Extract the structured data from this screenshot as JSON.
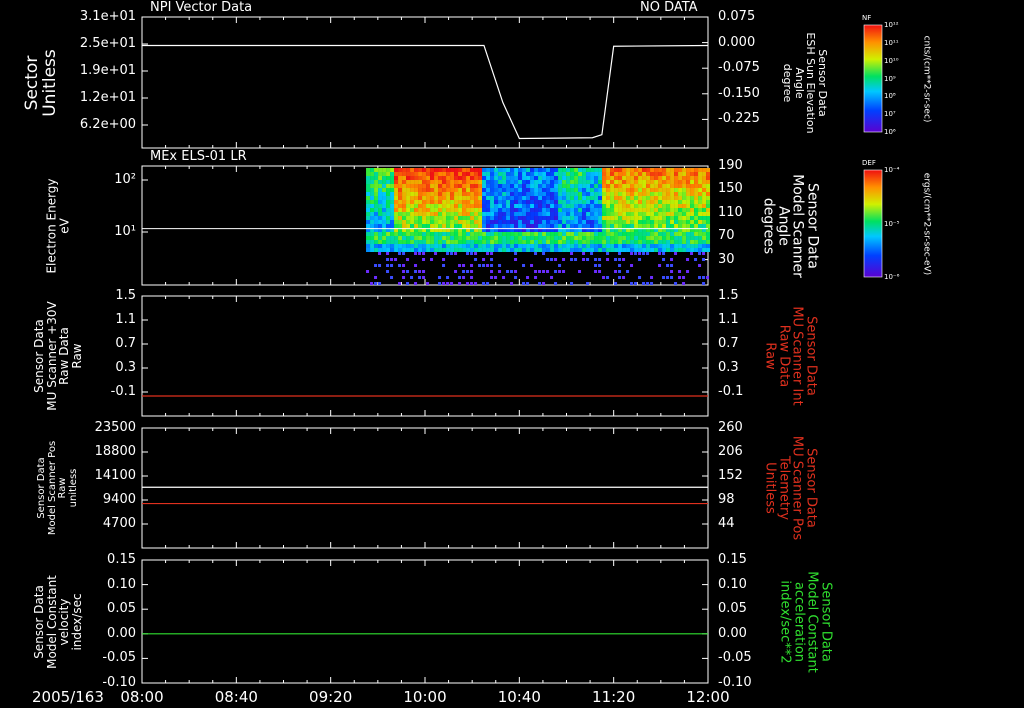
{
  "panel1": {
    "title": "NPI Vector Data",
    "status": "NO DATA",
    "left_label": "Sector\nUnitless",
    "right_label": "Sensor Data\nESH Sun Elevation\nAngle\ndegree",
    "left_ticks": [
      "3.1e+01",
      "2.5e+01",
      "1.9e+01",
      "1.2e+01",
      "6.2e+00"
    ],
    "right_ticks": [
      "0.075",
      "0.000",
      "-0.075",
      "-0.150",
      "-0.225"
    ],
    "colorbar_title": "NF",
    "colorbar_unit": "cnts/(cm**2-sr-sec)",
    "colorbar_ticks": [
      "10^12",
      "10^11",
      "10^10",
      "10^9",
      "10^8",
      "10^7",
      "10^6"
    ]
  },
  "panel2": {
    "title": "MEx ELS-01 LR",
    "left_label": "Electron Energy\neV",
    "right_label": "Sensor Data\nModel Scanner\nAngle\ndegrees",
    "left_ticks": [
      "10^2",
      "10^1"
    ],
    "right_ticks": [
      "190",
      "150",
      "110",
      "70",
      "30"
    ],
    "colorbar_title": "DEF",
    "colorbar_unit": "ergs/(cm**2-sr-sec-eV)",
    "colorbar_ticks": [
      "10^-4",
      "10^-5",
      "10^-6"
    ]
  },
  "panel3": {
    "left_label": "Sensor Data\nMU Scanner +30V\nRaw Data\nRaw",
    "right_label": "Sensor Data\nMU Scanner Int\nRaw Data\nRaw",
    "left_ticks": [
      "1.5",
      "1.1",
      "0.7",
      "0.3",
      "-0.1"
    ],
    "right_ticks": [
      "1.5",
      "1.1",
      "0.7",
      "0.3",
      "-0.1"
    ]
  },
  "panel4": {
    "left_label": "Sensor Data\nModel Scanner Pos\nRaw\nunitless",
    "right_label": "Sensor Data\nMU Scanner Pos\nTelemetry\nUnitless",
    "left_ticks": [
      "23500",
      "18800",
      "14100",
      "9400",
      "4700"
    ],
    "right_ticks": [
      "260",
      "206",
      "152",
      "98",
      "44"
    ]
  },
  "panel5": {
    "left_label": "Sensor Data\nModel Constant\nvelocity\nindex/sec",
    "right_label": "Sensor Data\nModel Constant\nacceleration\nindex/sec**2",
    "left_ticks": [
      "0.15",
      "0.10",
      "0.05",
      "0.00",
      "-0.05",
      "-0.10"
    ],
    "right_ticks": [
      "0.15",
      "0.10",
      "0.05",
      "0.00",
      "-0.05",
      "-0.10"
    ]
  },
  "xaxis": {
    "date": "2005/163",
    "ticks": [
      "08:00",
      "08:40",
      "09:20",
      "10:00",
      "10:40",
      "11:20",
      "12:00"
    ]
  },
  "colors": {
    "white": "#ffffff",
    "red": "#e0301e",
    "green": "#30e030"
  },
  "chart_data": [
    {
      "type": "line",
      "panel": "top",
      "x": [
        "08:00",
        "10:25",
        "10:33",
        "10:40",
        "11:11",
        "11:15",
        "11:20",
        "12:00"
      ],
      "series": [
        {
          "name": "Sensor Data ESH Sun Elevation Angle",
          "axis": "right",
          "values": [
            0.0,
            0.0,
            -0.15,
            -0.245,
            -0.243,
            -0.235,
            -0.002,
            0.0
          ]
        }
      ],
      "ylim_left": [
        0,
        31
      ],
      "ylim_right": [
        -0.27,
        0.075
      ]
    },
    {
      "type": "heatmap",
      "panel": "ELS spectrogram",
      "description_x_range": [
        "09:35",
        "12:00"
      ],
      "ylim": [
        1,
        200
      ],
      "ylog": true,
      "series": [
        {
          "name": "Sensor Data Model Scanner Angle",
          "axis": "right",
          "x": [
            "08:00",
            "12:00"
          ],
          "values": [
            90,
            90
          ]
        }
      ],
      "ylim_right": [
        0,
        190
      ]
    },
    {
      "type": "line",
      "panel": "3",
      "x": [
        "08:00",
        "12:00"
      ],
      "series": [
        {
          "name": "Sensor Data MU Scanner Int Raw Data",
          "axis": "right",
          "color": "red",
          "values": [
            0.0,
            0.0
          ]
        }
      ],
      "ylim": [
        -0.3,
        1.5
      ]
    },
    {
      "type": "line",
      "panel": "4",
      "x": [
        "08:00",
        "12:00"
      ],
      "series": [
        {
          "name": "Sensor Data Model Scanner Pos",
          "axis": "left",
          "color": "white",
          "values": [
            11900,
            11900
          ]
        },
        {
          "name": "Sensor Data MU Scanner Pos Telemetry",
          "axis": "right",
          "color": "red",
          "values": [
            90,
            90
          ]
        }
      ],
      "ylim_left": [
        0,
        23500
      ],
      "ylim_right": [
        -10,
        260
      ]
    },
    {
      "type": "line",
      "panel": "5",
      "x": [
        "08:00",
        "12:00"
      ],
      "series": [
        {
          "name": "Sensor Data Model Constant acceleration",
          "axis": "right",
          "color": "green",
          "values": [
            0.0,
            0.0
          ]
        }
      ],
      "ylim": [
        -0.1,
        0.15
      ]
    }
  ]
}
